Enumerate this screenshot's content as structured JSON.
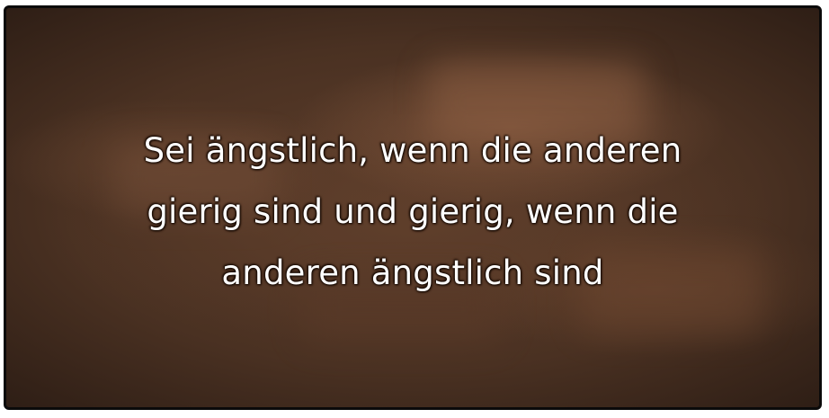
{
  "quote": {
    "lines": [
      "Sei ängstlich, wenn die anderen",
      "gierig sind und gierig, wenn die",
      "anderen ängstlich sind"
    ]
  },
  "colors": {
    "background_dark": "#2b1c14",
    "background_mid": "#5f3f2c",
    "text": "#ffffff",
    "frame_border": "#0b0a0a"
  }
}
